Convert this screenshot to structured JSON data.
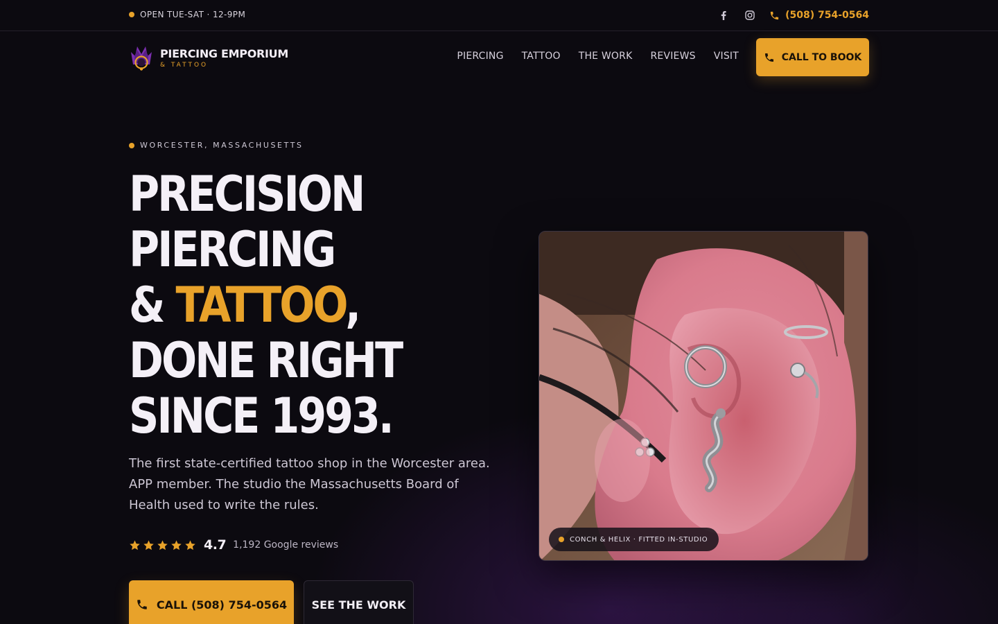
{
  "topbar": {
    "hours": "OPEN TUE-SAT · 12-9PM",
    "phone": "(508) 754-0564",
    "social_icons": [
      "facebook-icon",
      "instagram-icon"
    ]
  },
  "brand": {
    "name": "PIERCING EMPORIUM",
    "sub": "& TATTOO"
  },
  "nav": {
    "items": [
      {
        "label": "PIERCING"
      },
      {
        "label": "TATTOO"
      },
      {
        "label": "THE WORK"
      },
      {
        "label": "REVIEWS"
      },
      {
        "label": "VISIT"
      }
    ],
    "cta_label": "CALL TO BOOK"
  },
  "hero": {
    "eyebrow": "WORCESTER, MASSACHUSETTS",
    "headline_line1": "PRECISION",
    "headline_line2": "PIERCING",
    "headline_amp": "& ",
    "headline_accent": "TATTOO",
    "headline_comma": ",",
    "headline_line4": "DONE RIGHT",
    "headline_line5": "SINCE 1993.",
    "lede": "The first state-certified tattoo shop in the Worcester area. APP member. The studio the Massachusetts Board of Health used to write the rules.",
    "rating": {
      "stars": 5,
      "score": "4.7",
      "count_label": "1,192 Google reviews"
    },
    "primary_button": "CALL (508) 754-0564",
    "secondary_button": "SEE THE WORK"
  },
  "photo": {
    "caption": "CONCH & HELIX · FITTED IN-STUDIO"
  },
  "colors": {
    "accent": "#e8a22a",
    "background": "#0c0a10",
    "brand_purple": "#7b2fb0"
  }
}
